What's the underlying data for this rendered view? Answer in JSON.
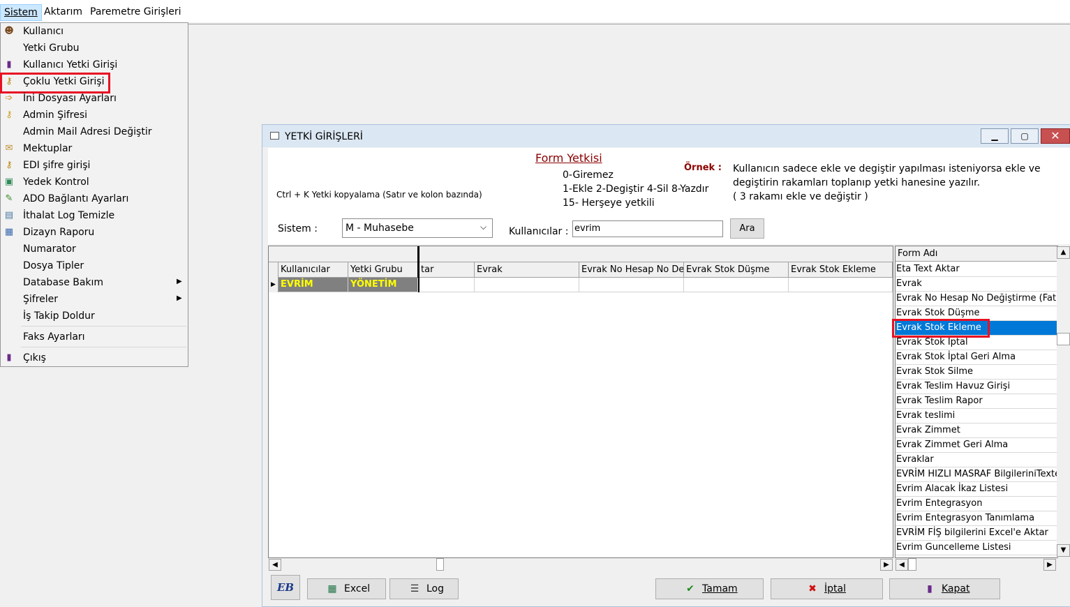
{
  "menubar": {
    "items": [
      {
        "label": "Sistem"
      },
      {
        "label": "Aktarım"
      },
      {
        "label": "Paremetre Girişleri"
      }
    ]
  },
  "dropdown": {
    "items": [
      {
        "label": "Kullanıcı",
        "icon": "user-icon"
      },
      {
        "label": "Yetki Grubu",
        "icon": ""
      },
      {
        "label": "Kullanıcı Yetki Girişi",
        "icon": "key-user-icon"
      },
      {
        "label": "Çoklu Yetki Girişi",
        "icon": "multi-key-icon"
      },
      {
        "label": "İni Dosyası  Ayarları",
        "icon": "settings-file-icon"
      },
      {
        "label": "Admin Şifresi",
        "icon": "key-icon"
      },
      {
        "label": "Admin Mail Adresi Değiştir",
        "icon": ""
      },
      {
        "label": "Mektuplar",
        "icon": "letter-icon"
      },
      {
        "label": "EDI şifre girişi",
        "icon": "edi-key-icon"
      },
      {
        "label": "Yedek Kontrol",
        "icon": "backup-icon"
      },
      {
        "label": "ADO Bağlantı Ayarları",
        "icon": "connection-icon"
      },
      {
        "label": "İthalat Log Temizle",
        "icon": "log-clean-icon"
      },
      {
        "label": "Dizayn Raporu",
        "icon": "report-icon"
      },
      {
        "label": "Numarator",
        "icon": ""
      },
      {
        "label": "Dosya Tipler",
        "icon": ""
      },
      {
        "label": "Database Bakım",
        "icon": "",
        "submenu": true
      },
      {
        "label": "Şifreler",
        "icon": "",
        "submenu": true
      },
      {
        "label": "İş Takip Doldur",
        "icon": ""
      },
      {
        "label": "Faks Ayarları",
        "icon": ""
      },
      {
        "label": "Çıkış",
        "icon": "exit-icon"
      }
    ]
  },
  "window": {
    "title": "YETKİ GİRİŞLERİ",
    "form_yetkisi_title": "Form Yetkisi",
    "copy_hint": "Ctrl + K Yetki kopyalama (Satır ve kolon bazında)",
    "legend": [
      "0-Giremez",
      "1-Ekle  2-Degiştir  4-Sil  8-Yazdır",
      "15- Herşeye yetkili"
    ],
    "ornek_label": "Örnek :",
    "ornek_lines": [
      "Kullanıcın sadece ekle ve degiştir yapılması isteniyorsa  ekle ve",
      "degiştirin rakamları toplanıp yetki hanesine yazılır.",
      " ( 3 rakamı ekle ve değiştir )"
    ],
    "sistem_label": "Sistem :",
    "sistem_value": "M - Muhasebe",
    "kullanicilar_label": "Kullanıcılar :",
    "kullanicilar_value": "evrim",
    "ara_button": "Ara"
  },
  "grid": {
    "columns": [
      "Kullanıcılar",
      "Yetki Grubu",
      "tar",
      "Evrak",
      "Evrak No Hesap No De",
      "Evrak Stok Düşme",
      "Evrak Stok Ekleme"
    ],
    "rows": [
      {
        "kullanici": "EVRİM",
        "grup": "YÖNETİM"
      }
    ]
  },
  "form_list": {
    "header": "Form Adı",
    "items": [
      "Eta Text Aktar",
      "Evrak",
      "Evrak No Hesap No Değiştirme (Fatura",
      "Evrak Stok Düşme",
      "Evrak Stok Ekleme",
      "Evrak Stok İptal",
      "Evrak Stok İptal Geri Alma",
      "Evrak Stok Silme",
      "Evrak Teslim Havuz Girişi",
      "Evrak Teslim Rapor",
      "Evrak teslimi",
      "Evrak Zimmet",
      "Evrak Zimmet Geri Alma",
      "Evraklar",
      "EVRİM  HIZLI MASRAF BilgileriniTexte",
      "Evrim Alacak İkaz Listesi",
      "Evrim Entegrasyon",
      "Evrim Entegrasyon Tanımlama",
      "EVRİM FİŞ bilgilerini Excel'e Aktar",
      "Evrim Guncelleme Listesi"
    ],
    "selected": "Evrak Stok Ekleme"
  },
  "buttons": {
    "logo": "EB",
    "excel": "Excel",
    "log": "Log",
    "tamam": "Tamam",
    "iptal": "İptal",
    "kapat": "Kapat"
  },
  "colors": {
    "highlight_red": "#e81123",
    "selection_blue": "#0078d7",
    "title_dark_red": "#8b0000",
    "grid_user_text": "#ffff00"
  }
}
